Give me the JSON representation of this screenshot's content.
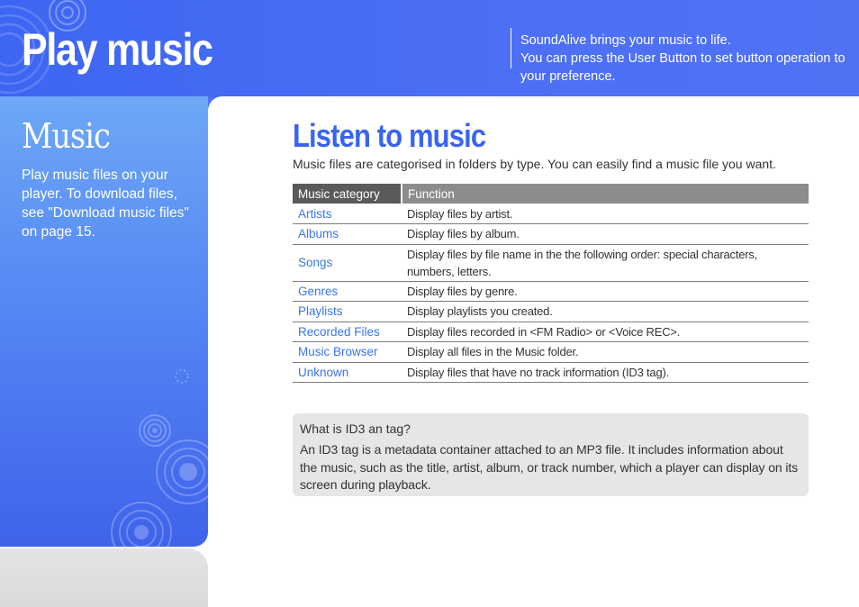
{
  "header": {
    "title": "Play music",
    "tagline": "SoundAlive brings your music to life.",
    "description": "You can press the User Button to set button operation to your preference."
  },
  "sidebar": {
    "title": "Music",
    "description": "Play music files on your player. To download files, see \"Download music files\" on page 15."
  },
  "main": {
    "section_title": "Listen to music",
    "intro": "Music files are categorised in folders by type. You can easily find a music file you want.",
    "table": {
      "headers": [
        "Music category",
        "Function"
      ],
      "rows": [
        {
          "category": "Artists",
          "function": "Display files by artist."
        },
        {
          "category": "Albums",
          "function": "Display files by album."
        },
        {
          "category": "Songs",
          "function": "Display files by file name in the the following order: special characters, numbers, letters."
        },
        {
          "category": "Genres",
          "function": "Display files by genre."
        },
        {
          "category": "Playlists",
          "function": "Display playlists you created."
        },
        {
          "category": "Recorded Files",
          "function": "Display files recorded in <FM Radio> or <Voice REC>."
        },
        {
          "category": "Music Browser",
          "function": "Display all files in the Music folder."
        },
        {
          "category": "Unknown",
          "function": "Display files that have no track information (ID3 tag)."
        }
      ]
    },
    "note": {
      "title": "What is ID3 an tag?",
      "body": "An ID3 tag is a metadata container attached to an MP3 file. It includes information about the music, such as the title, artist, album, or track number, which a player can display on its screen during playback."
    }
  },
  "colors": {
    "header_blue": "#4d6ff5",
    "accent_blue": "#3a64f0",
    "link_blue": "#3a75ee",
    "table_header_dark": "#5a5a5a",
    "table_header_light": "#8c8c8c",
    "note_bg": "#e6e6e6"
  }
}
